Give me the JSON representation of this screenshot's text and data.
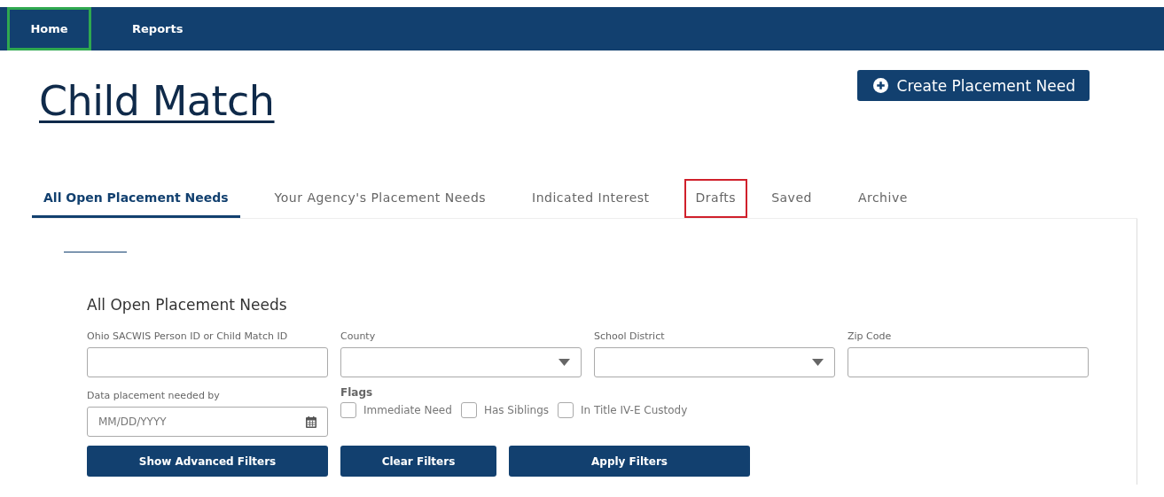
{
  "nav": [
    {
      "label": "Home",
      "highlighted": true
    },
    {
      "label": "Reports",
      "highlighted": false
    }
  ],
  "title": "Child Match",
  "create_button": {
    "label": "Create Placement Need"
  },
  "tabs": [
    {
      "label": "All Open Placement Needs",
      "selected": true,
      "highlighted": false
    },
    {
      "label": "Your Agency's Placement Needs",
      "selected": false,
      "highlighted": false
    },
    {
      "label": "Indicated Interest",
      "selected": false,
      "highlighted": false
    },
    {
      "label": "Drafts",
      "selected": false,
      "highlighted": true
    },
    {
      "label": "Saved",
      "selected": false,
      "highlighted": false
    },
    {
      "label": "Archive",
      "selected": false,
      "highlighted": false
    }
  ],
  "section_title": "All Open Placement Needs",
  "fields": [
    {
      "kind": "text",
      "label": "Ohio SACWIS Person ID or Child Match ID"
    },
    {
      "kind": "select",
      "label": "County"
    },
    {
      "kind": "select",
      "label": "School District"
    },
    {
      "kind": "text",
      "label": "Zip Code"
    }
  ],
  "date_field": {
    "label": "Data placement needed by",
    "placeholder": "MM/DD/YYYY"
  },
  "flags": {
    "label": "Flags",
    "items": [
      {
        "label": "Immediate Need",
        "checked": false
      },
      {
        "label": "Has Siblings",
        "checked": false
      },
      {
        "label": "In Title IV-E Custody",
        "checked": false
      }
    ]
  },
  "buttons": [
    "Show Advanced Filters",
    "Clear Filters",
    "Apply Filters"
  ]
}
